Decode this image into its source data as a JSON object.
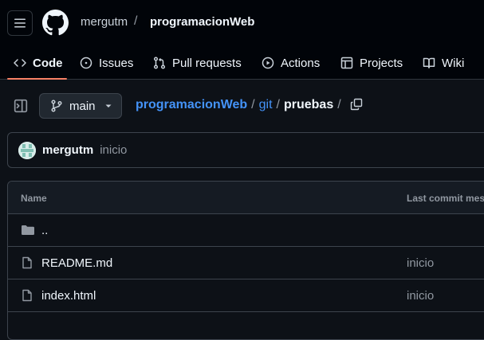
{
  "header": {
    "owner": "mergutm",
    "separator": "/",
    "repo": "programacionWeb"
  },
  "tabs": [
    {
      "label": "Code",
      "icon": "code-icon",
      "active": true
    },
    {
      "label": "Issues",
      "icon": "issue-opened-icon"
    },
    {
      "label": "Pull requests",
      "icon": "git-pull-request-icon"
    },
    {
      "label": "Actions",
      "icon": "play-icon"
    },
    {
      "label": "Projects",
      "icon": "table-icon"
    },
    {
      "label": "Wiki",
      "icon": "book-icon"
    }
  ],
  "branch": {
    "label": "main"
  },
  "breadcrumb": {
    "repo": "programacionWeb",
    "sep": "/",
    "dir1": "git",
    "current": "pruebas",
    "trailing_sep": "/"
  },
  "commit": {
    "author": "mergutm",
    "message": "inicio"
  },
  "table": {
    "col_name": "Name",
    "col_commit": "Last commit message",
    "rows": [
      {
        "name": "..",
        "type": "parent-dir",
        "message": ""
      },
      {
        "name": "README.md",
        "type": "file",
        "message": "inicio"
      },
      {
        "name": "index.html",
        "type": "file",
        "message": "inicio"
      }
    ]
  },
  "colors": {
    "background": "#0d1117",
    "header_bg": "#010409",
    "link": "#4493f8",
    "active_underline": "#f78166",
    "muted": "#9198a1",
    "border": "#3d444d"
  }
}
